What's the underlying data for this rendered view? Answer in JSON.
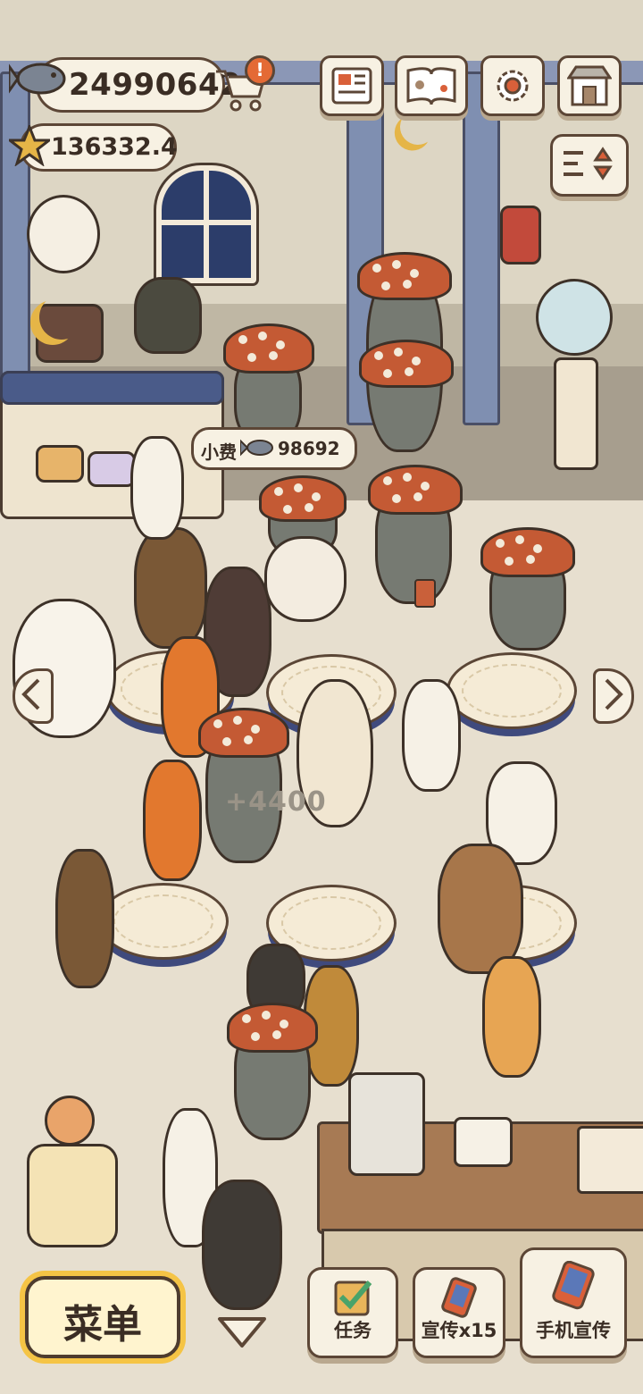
{
  "hud": {
    "fish_currency": "24990642",
    "star_currency": "136332.4",
    "cart_alert": "!"
  },
  "top_buttons": [
    "newspaper-icon",
    "paw-book-icon",
    "settings-gear-icon",
    "shop-icon"
  ],
  "scene": {
    "tip_label": "小费",
    "tip_value": "98692",
    "floating_reward": "+4400"
  },
  "bottom_bar": {
    "menu_label": "菜单",
    "task_label": "任务",
    "promo_label": "宣传x15",
    "phone_promo_label": "手机宣传"
  },
  "colors": {
    "panel": "#f7f1e3",
    "outline": "#5c4636",
    "accent_yellow": "#f5c445",
    "mushroom_red": "#c45a34",
    "floor": "#e7dfcf"
  }
}
